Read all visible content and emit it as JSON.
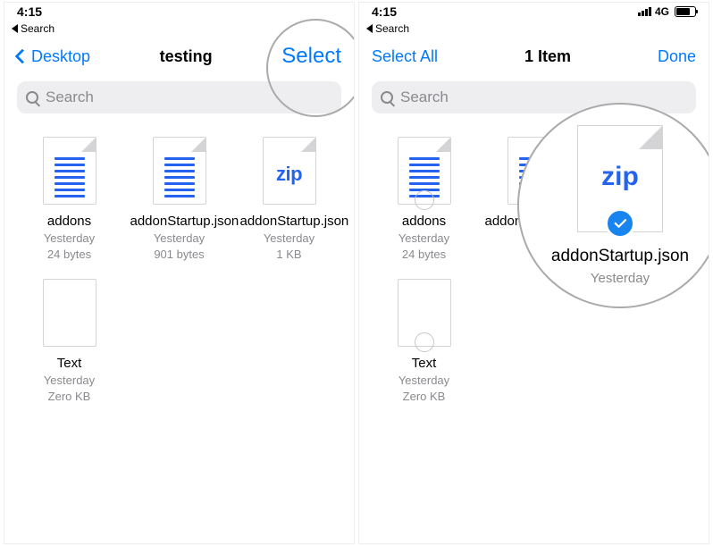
{
  "left": {
    "status": {
      "time": "4:15"
    },
    "breadcrumb": "Search",
    "nav": {
      "back": "Desktop",
      "title": "testing",
      "action": "Select"
    },
    "search": {
      "placeholder": "Search"
    },
    "files": [
      {
        "name": "addons",
        "date": "Yesterday",
        "size": "24 bytes",
        "kind": "doc"
      },
      {
        "name": "addonStartup.json",
        "date": "Yesterday",
        "size": "901 bytes",
        "kind": "doc"
      },
      {
        "name": "addonStartup.json",
        "date": "Yesterday",
        "size": "1 KB",
        "kind": "zip"
      },
      {
        "name": "Text",
        "date": "Yesterday",
        "size": "Zero KB",
        "kind": "blank"
      }
    ]
  },
  "right": {
    "status": {
      "time": "4:15",
      "network": "4G"
    },
    "breadcrumb": "Search",
    "nav": {
      "left": "Select All",
      "title": "1 Item",
      "action": "Done"
    },
    "search": {
      "placeholder": "Search"
    },
    "files": [
      {
        "name": "addons",
        "date": "Yesterday",
        "size": "24 bytes",
        "kind": "doc",
        "selected": false
      },
      {
        "name": "addonStartup.jso",
        "date": "",
        "size": "",
        "kind": "doc",
        "selected": false
      },
      {
        "name": "",
        "date": "",
        "size": "",
        "kind": "zip",
        "selected": true
      },
      {
        "name": "Text",
        "date": "Yesterday",
        "size": "Zero KB",
        "kind": "blank",
        "selected": false
      }
    ],
    "zoom": {
      "zip_label": "zip",
      "name": "addonStartup.json",
      "date": "Yesterday"
    }
  },
  "icons": {
    "zip_text": "zip"
  }
}
